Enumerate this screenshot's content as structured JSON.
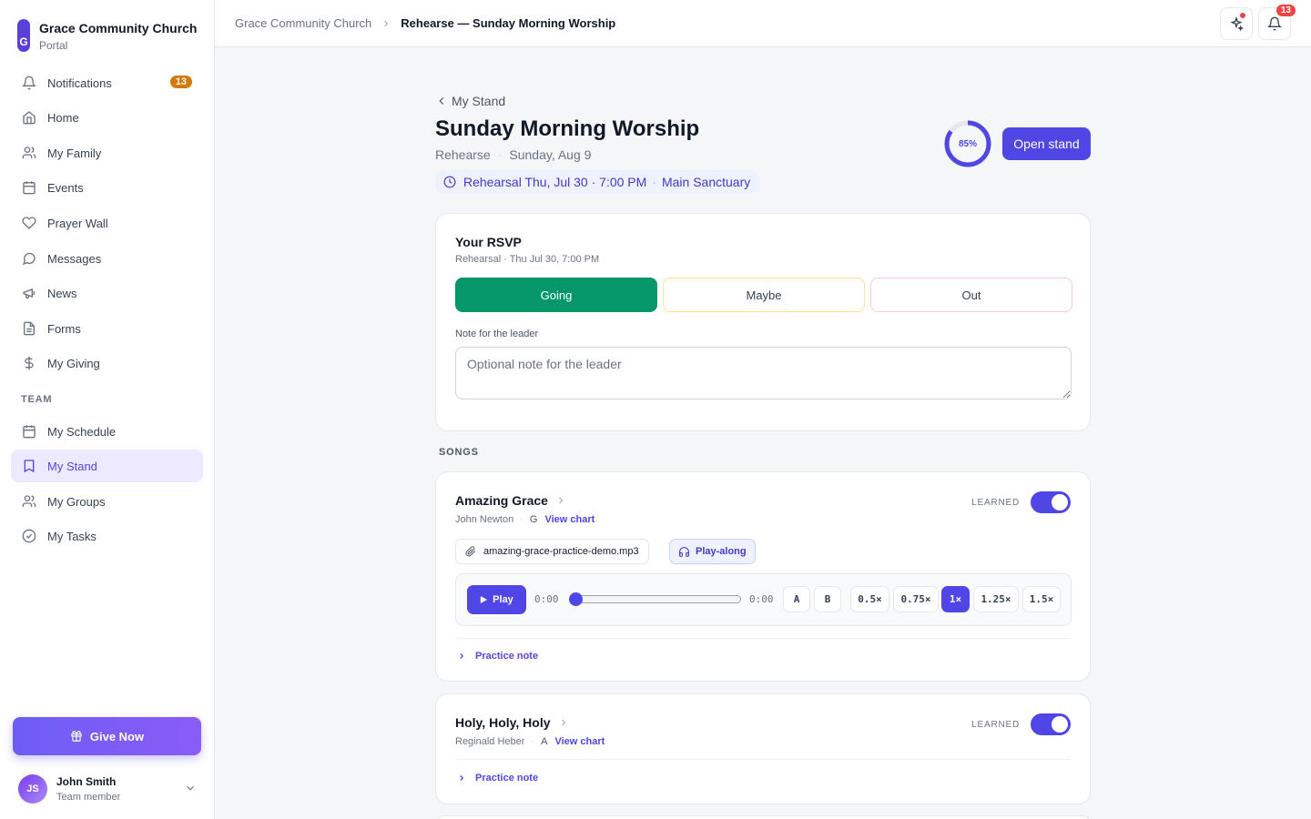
{
  "brand": {
    "initial": "G",
    "name": "Grace Community Church",
    "subtitle": "Portal"
  },
  "sidebar": {
    "items": [
      {
        "label": "Notifications",
        "icon": "bell-icon",
        "badge": "13"
      },
      {
        "label": "Home",
        "icon": "home-icon"
      },
      {
        "label": "My Family",
        "icon": "users-icon"
      },
      {
        "label": "Events",
        "icon": "calendar-icon"
      },
      {
        "label": "Prayer Wall",
        "icon": "heart-icon"
      },
      {
        "label": "Messages",
        "icon": "message-icon"
      },
      {
        "label": "News",
        "icon": "megaphone-icon"
      },
      {
        "label": "Forms",
        "icon": "file-icon"
      },
      {
        "label": "My Giving",
        "icon": "dollar-icon"
      }
    ],
    "team_label": "TEAM",
    "team_items": [
      {
        "label": "My Schedule",
        "icon": "calendar-icon"
      },
      {
        "label": "My Stand",
        "icon": "book-icon",
        "active": true
      },
      {
        "label": "My Groups",
        "icon": "users-icon"
      },
      {
        "label": "My Tasks",
        "icon": "check-circle-icon"
      }
    ],
    "give_label": "Give Now",
    "user": {
      "initials": "JS",
      "name": "John Smith",
      "role": "Team member"
    }
  },
  "header": {
    "breadcrumb": [
      "Grace Community Church",
      "Rehearse — Sunday Morning Worship"
    ],
    "bell_badge": "13"
  },
  "page": {
    "back_label": "My Stand",
    "title": "Sunday Morning Worship",
    "mode": "Rehearse",
    "date": "Sunday, Aug 9",
    "rehearsal": "Rehearsal Thu, Jul 30 · 7:00 PM",
    "location": "Main Sanctuary",
    "progress_label": "85%",
    "progress_fraction": 0.85,
    "open_stand_label": "Open stand"
  },
  "rsvp": {
    "title": "Your RSVP",
    "subtitle": "Rehearsal · Thu Jul 30, 7:00 PM",
    "options": [
      "Going",
      "Maybe",
      "Out"
    ],
    "selected": "Going",
    "note_label": "Note for the leader",
    "note_placeholder": "Optional note for the leader",
    "note_value": ""
  },
  "songs_label": "SONGS",
  "songs": [
    {
      "title": "Amazing Grace",
      "author": "John Newton",
      "key": "G",
      "chart_label": "View chart",
      "learned_label": "LEARNED",
      "learned": true,
      "file": "amazing-grace-practice-demo.mp3",
      "playalong_label": "Play-along",
      "player": {
        "play_label": "Play",
        "time_current": "0:00",
        "time_total": "0:00",
        "loop_a": "A",
        "loop_b": "B",
        "speeds": [
          "0.5×",
          "0.75×",
          "1×",
          "1.25×",
          "1.5×"
        ],
        "active_speed": "1×",
        "position_fraction": 0
      },
      "practice_label": "Practice note"
    },
    {
      "title": "Holy, Holy, Holy",
      "author": "Reginald Heber",
      "key": "A",
      "chart_label": "View chart",
      "learned_label": "LEARNED",
      "learned": true,
      "practice_label": "Practice note"
    }
  ],
  "colors": {
    "accent": "#4f46e5",
    "going": "#059669",
    "badge": "#d97706",
    "alert": "#ef4444"
  }
}
